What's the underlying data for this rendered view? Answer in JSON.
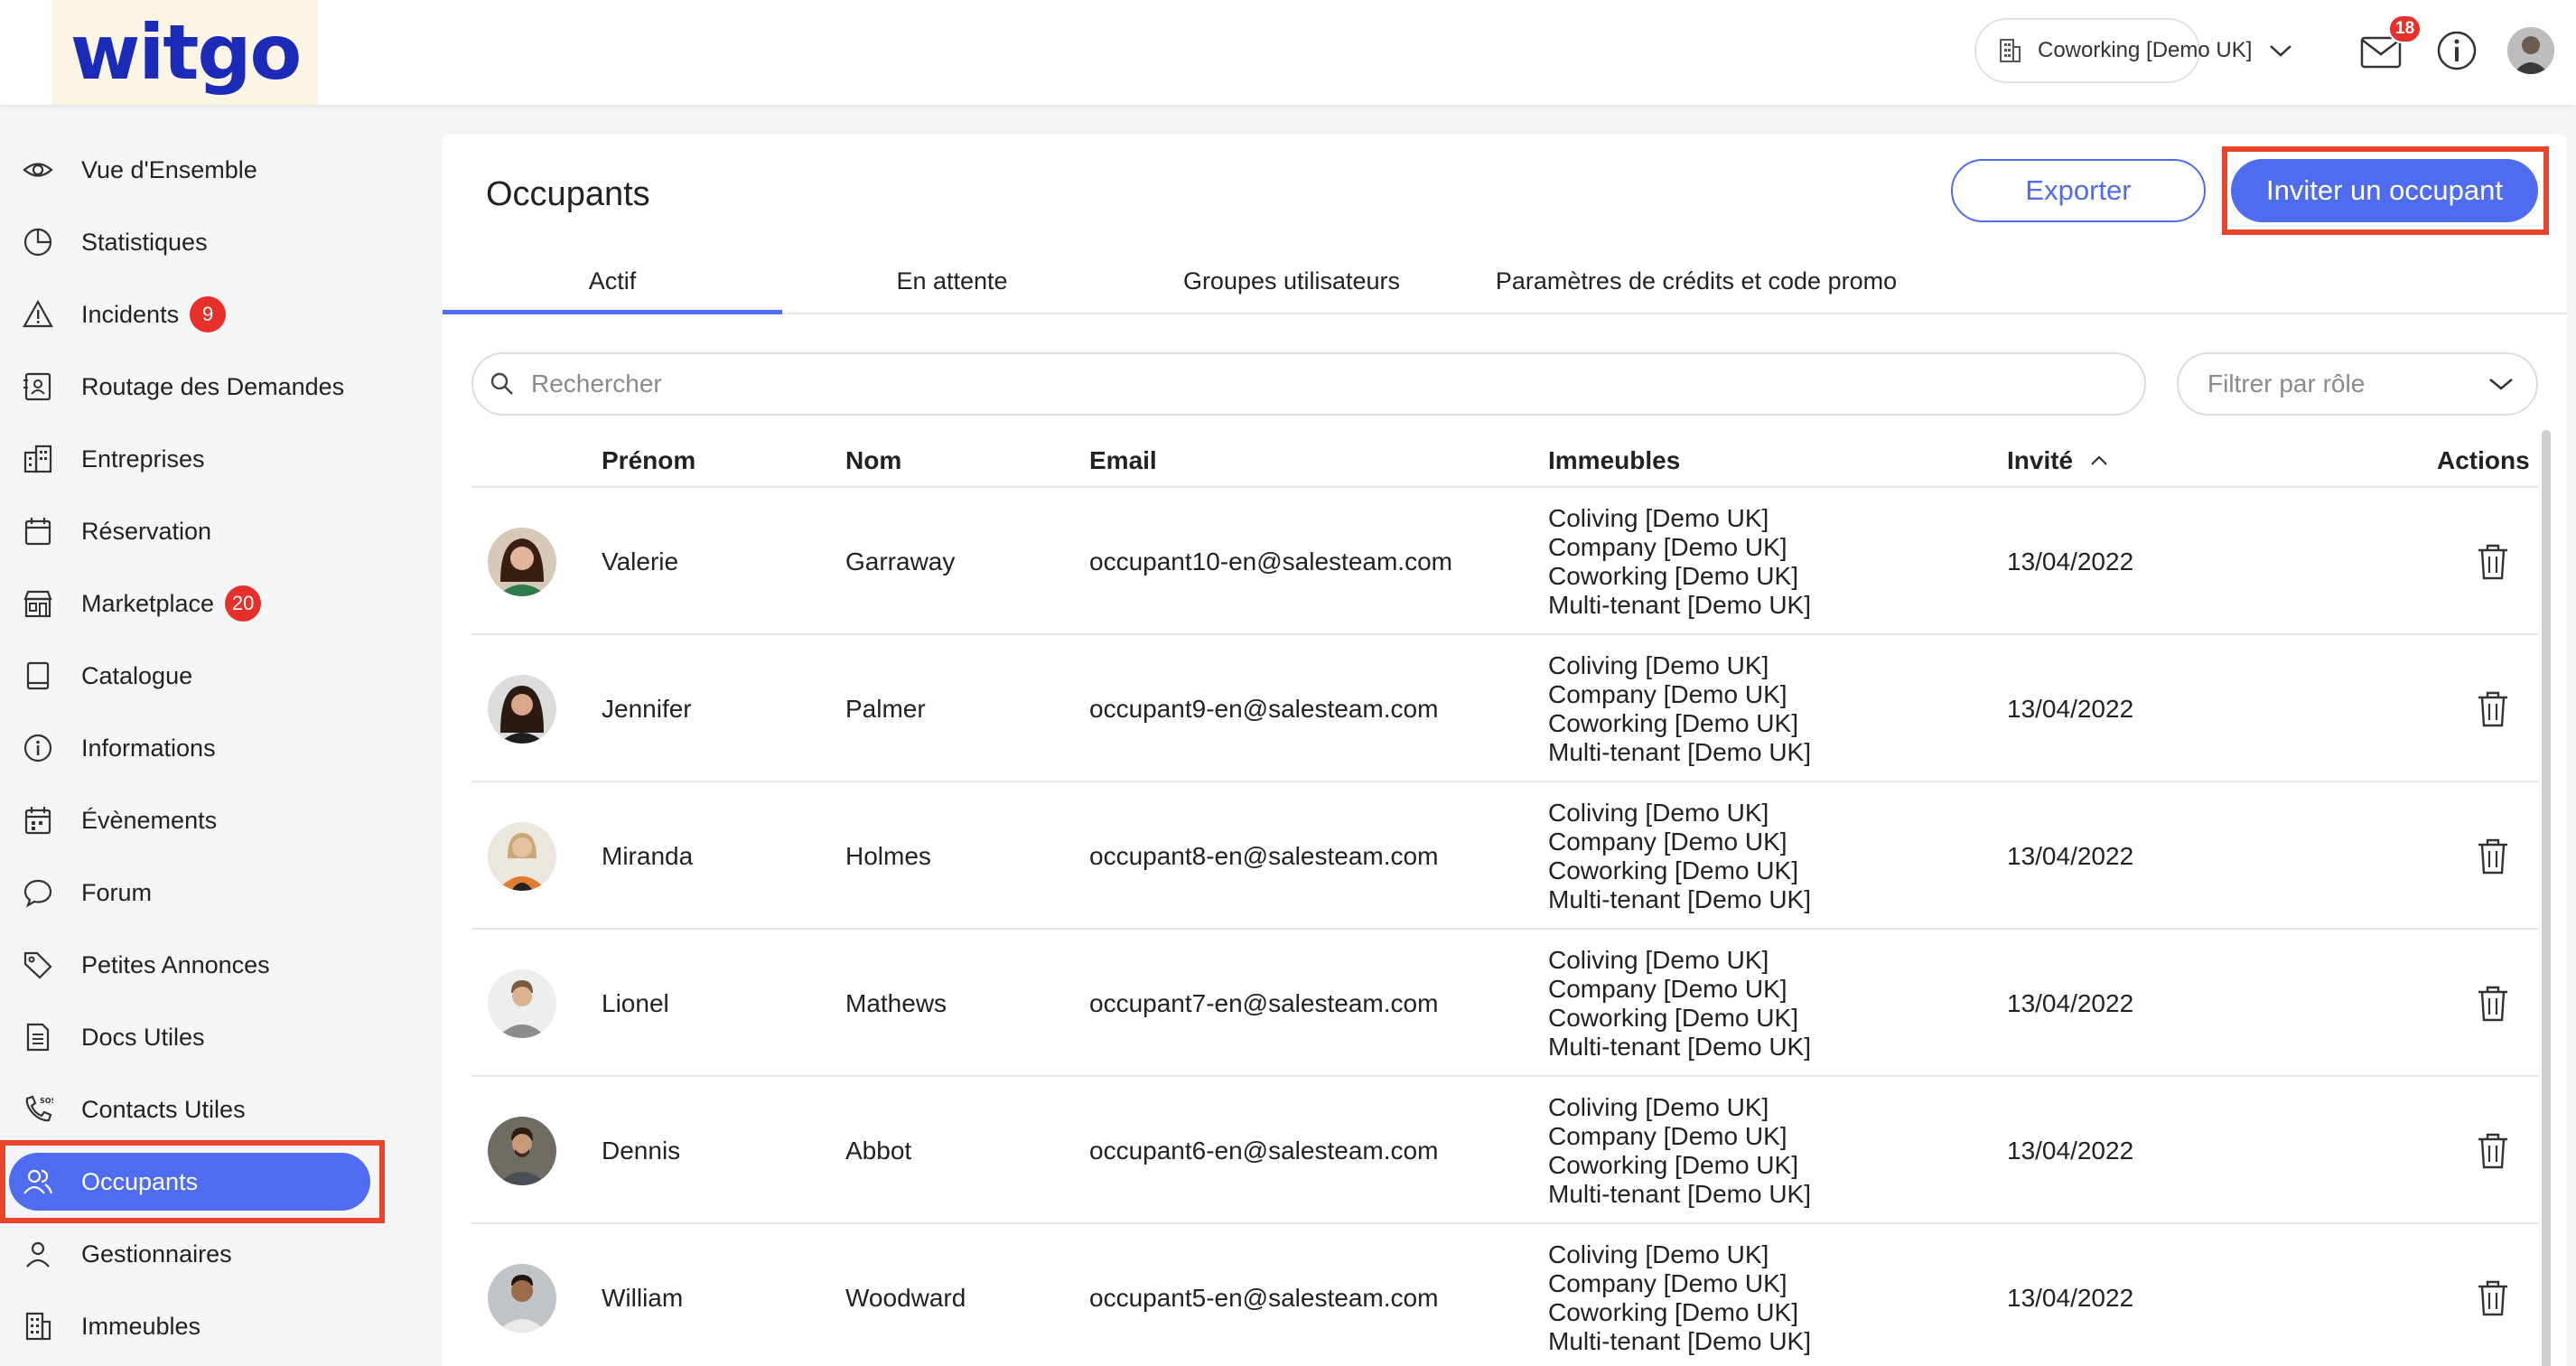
{
  "brand": {
    "logo": "witgo"
  },
  "header": {
    "building_selector": "Coworking [Demo UK]",
    "mail_count": "18"
  },
  "sidebar": {
    "items": [
      {
        "label": "Vue d'Ensemble",
        "icon": "eye-icon"
      },
      {
        "label": "Statistiques",
        "icon": "pie-chart-icon"
      },
      {
        "label": "Incidents",
        "icon": "warning-icon",
        "badge": "9"
      },
      {
        "label": "Routage des Demandes",
        "icon": "contact-card-icon"
      },
      {
        "label": "Entreprises",
        "icon": "buildings-icon"
      },
      {
        "label": "Réservation",
        "icon": "calendar-icon"
      },
      {
        "label": "Marketplace",
        "icon": "store-icon",
        "badge": "20"
      },
      {
        "label": "Catalogue",
        "icon": "book-icon"
      },
      {
        "label": "Informations",
        "icon": "info-circle-icon"
      },
      {
        "label": "Évènements",
        "icon": "event-calendar-icon"
      },
      {
        "label": "Forum",
        "icon": "chat-bubble-icon"
      },
      {
        "label": "Petites Annonces",
        "icon": "tag-icon"
      },
      {
        "label": "Docs Utiles",
        "icon": "document-icon"
      },
      {
        "label": "Contacts Utiles",
        "icon": "phone-sos-icon"
      },
      {
        "label": "Occupants",
        "icon": "users-icon",
        "active": true
      },
      {
        "label": "Gestionnaires",
        "icon": "user-icon"
      },
      {
        "label": "Immeubles",
        "icon": "building-icon"
      }
    ]
  },
  "main": {
    "title": "Occupants",
    "export_label": "Exporter",
    "invite_label": "Inviter un occupant",
    "tabs": [
      "Actif",
      "En attente",
      "Groupes utilisateurs",
      "Paramètres de crédits et code promo"
    ],
    "search_placeholder": "Rechercher",
    "role_filter_placeholder": "Filtrer par rôle",
    "columns": {
      "first_name": "Prénom",
      "last_name": "Nom",
      "email": "Email",
      "buildings": "Immeubles",
      "invited": "Invité",
      "actions": "Actions"
    },
    "rows": [
      {
        "first": "Valerie",
        "last": "Garraway",
        "email": "occupant10-en@salesteam.com",
        "buildings": [
          "Coliving [Demo UK]",
          "Company [Demo UK]",
          "Coworking [Demo UK]",
          "Multi-tenant [Demo UK]"
        ],
        "invited": "13/04/2022"
      },
      {
        "first": "Jennifer",
        "last": "Palmer",
        "email": "occupant9-en@salesteam.com",
        "buildings": [
          "Coliving [Demo UK]",
          "Company [Demo UK]",
          "Coworking [Demo UK]",
          "Multi-tenant [Demo UK]"
        ],
        "invited": "13/04/2022"
      },
      {
        "first": "Miranda",
        "last": "Holmes",
        "email": "occupant8-en@salesteam.com",
        "buildings": [
          "Coliving [Demo UK]",
          "Company [Demo UK]",
          "Coworking [Demo UK]",
          "Multi-tenant [Demo UK]"
        ],
        "invited": "13/04/2022"
      },
      {
        "first": "Lionel",
        "last": "Mathews",
        "email": "occupant7-en@salesteam.com",
        "buildings": [
          "Coliving [Demo UK]",
          "Company [Demo UK]",
          "Coworking [Demo UK]",
          "Multi-tenant [Demo UK]"
        ],
        "invited": "13/04/2022"
      },
      {
        "first": "Dennis",
        "last": "Abbot",
        "email": "occupant6-en@salesteam.com",
        "buildings": [
          "Coliving [Demo UK]",
          "Company [Demo UK]",
          "Coworking [Demo UK]",
          "Multi-tenant [Demo UK]"
        ],
        "invited": "13/04/2022"
      },
      {
        "first": "William",
        "last": "Woodward",
        "email": "occupant5-en@salesteam.com",
        "buildings": [
          "Coliving [Demo UK]",
          "Company [Demo UK]",
          "Coworking [Demo UK]",
          "Multi-tenant [Demo UK]"
        ],
        "invited": "13/04/2022"
      }
    ]
  },
  "colors": {
    "accent": "#4f6bef",
    "badge": "#e6302c",
    "highlight": "#e8452b",
    "logo": "#1b2bb8"
  }
}
